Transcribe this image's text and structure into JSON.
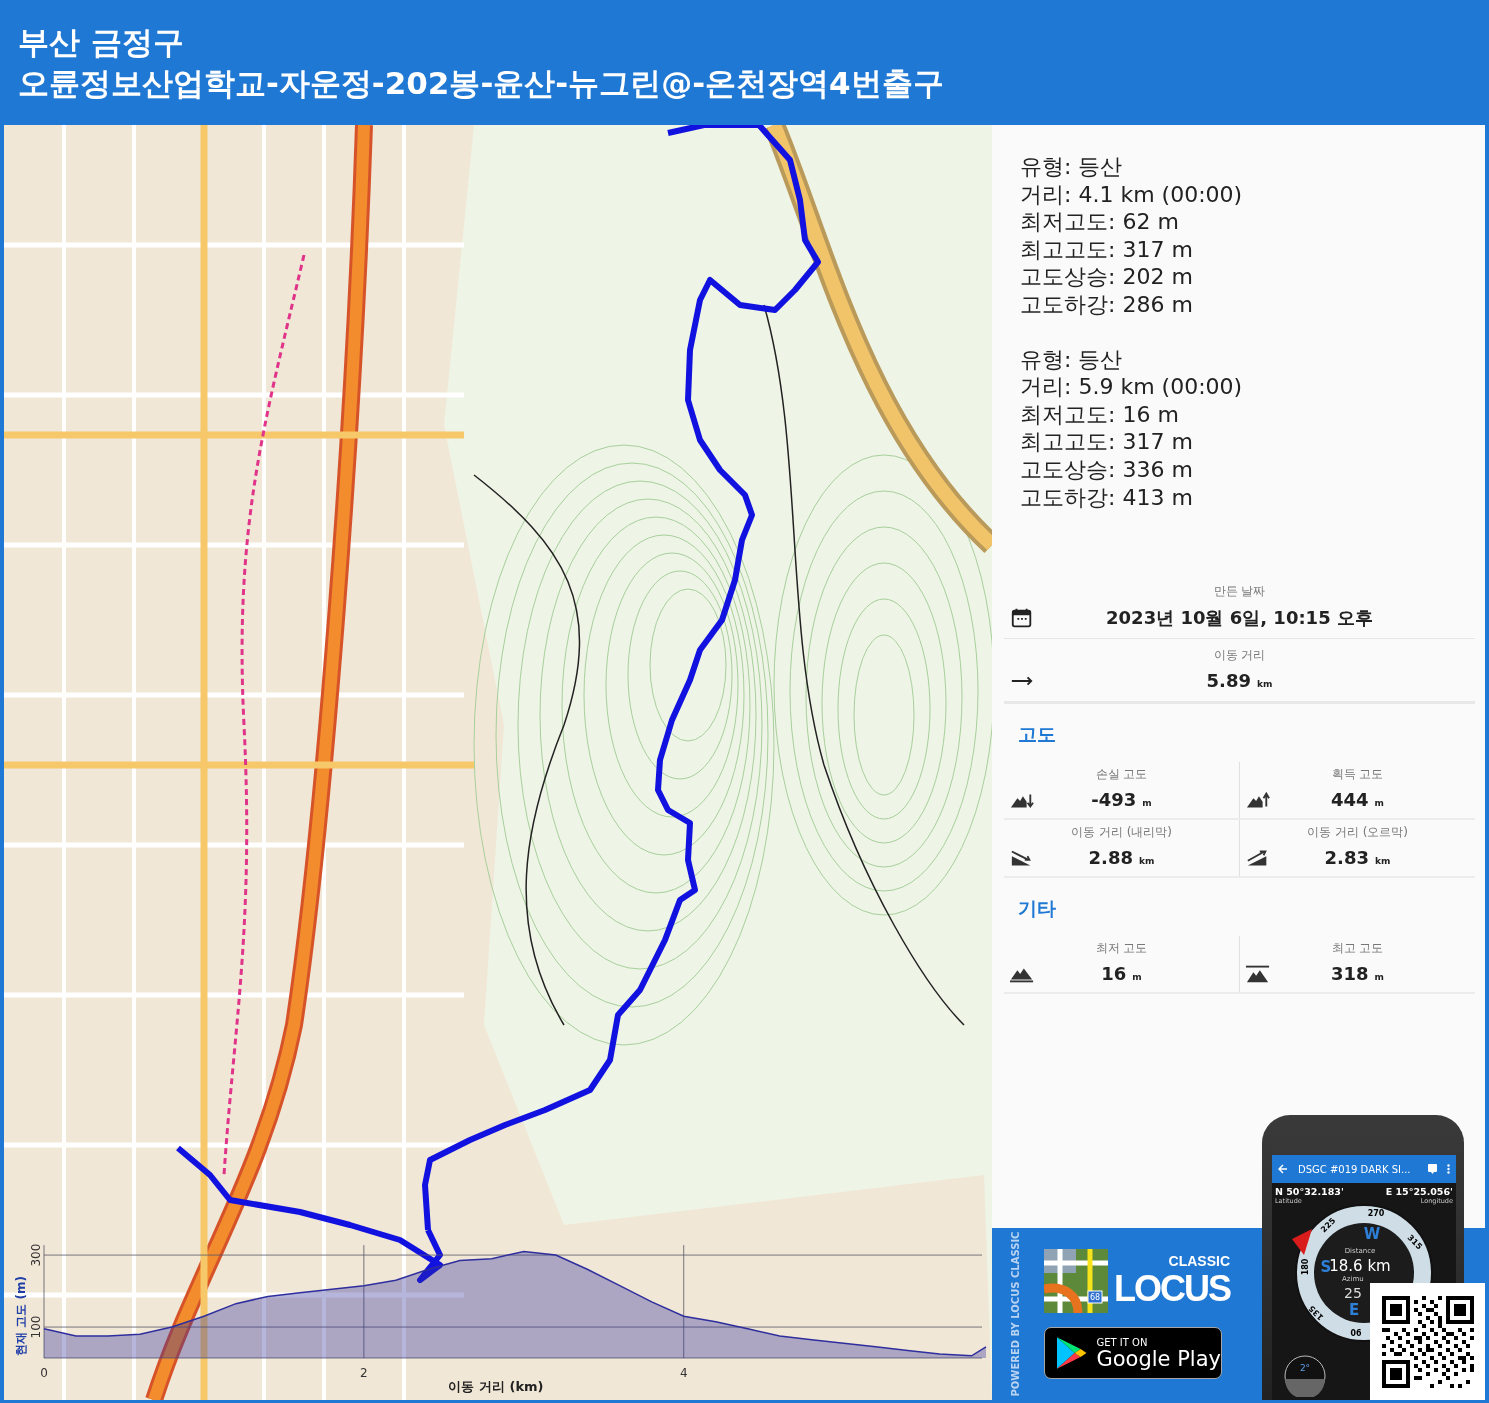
{
  "header": {
    "title_lines": [
      "부산 금정구",
      "오륜정보산업학교-자운정-202봉-윤산-뉴그린@-온천장역4번출구"
    ]
  },
  "map": {
    "elevation_chart": {
      "chart_data": {
        "type": "area",
        "xlabel": "이동 거리 (km)",
        "ylabel": "현재 고도 (m)",
        "x": [
          0,
          0.2,
          0.4,
          0.6,
          0.8,
          1.0,
          1.2,
          1.4,
          1.6,
          1.8,
          2.0,
          2.2,
          2.4,
          2.6,
          2.8,
          3.0,
          3.2,
          3.4,
          3.6,
          3.8,
          4.0,
          4.2,
          4.4,
          4.6,
          4.8,
          5.0,
          5.2,
          5.4,
          5.6,
          5.8,
          5.89
        ],
        "series": [
          {
            "color": "#2e2e9e",
            "values": [
              95,
              75,
              75,
              80,
              100,
              130,
              165,
              185,
              195,
              205,
              215,
              230,
              260,
              285,
              290,
              310,
              300,
              260,
              215,
              170,
              130,
              115,
              95,
              75,
              65,
              55,
              45,
              35,
              25,
              20,
              45
            ]
          }
        ],
        "xlim": [
          0,
          5.89
        ],
        "ylim": [
          14,
          328
        ],
        "xticks": [
          0,
          2,
          4
        ],
        "yticks": [
          100,
          300
        ],
        "grid": true
      }
    }
  },
  "summary": [
    {
      "lines": [
        "유형: 등산",
        "거리: 4.1 km (00:00)",
        "최저고도: 62 m",
        "최고고도: 317 m",
        "고도상승: 202 m",
        "고도하강: 286 m"
      ]
    },
    {
      "lines": [
        "유형: 등산",
        "거리: 5.9 km (00:00)",
        "최저고도: 16 m",
        "최고고도: 317 m",
        "고도상승: 336 m",
        "고도하강: 413 m"
      ]
    }
  ],
  "created": {
    "label": "만든 날짜",
    "value": "2023년 10월 6일, 10:15 오후"
  },
  "distance": {
    "label": "이동 거리",
    "value": "5.89",
    "unit": "km"
  },
  "sections": [
    {
      "title": "고도",
      "rows": [
        [
          {
            "kind": "descent",
            "label": "손실 고도",
            "value": "-493",
            "unit": "m"
          },
          {
            "kind": "ascent",
            "label": "획득 고도",
            "value": "444",
            "unit": "m"
          }
        ],
        [
          {
            "kind": "downhill",
            "label": "이동 거리 (내리막)",
            "value": "2.88",
            "unit": "km"
          },
          {
            "kind": "uphill",
            "label": "이동 거리 (오르막)",
            "value": "2.83",
            "unit": "km"
          }
        ]
      ]
    },
    {
      "title": "기타",
      "rows": [
        [
          {
            "kind": "lowest",
            "label": "최저 고도",
            "value": "16",
            "unit": "m"
          },
          {
            "kind": "highest",
            "label": "최고 고도",
            "value": "318",
            "unit": "m"
          }
        ]
      ]
    }
  ],
  "ad": {
    "powered_by": "POWERED BY LOCUS CLASSIC",
    "logo_small": "CLASSIC",
    "logo_big": "LOCUS",
    "logo_badge": "68",
    "store_small": "GET IT ON",
    "store_big": "Google Play",
    "phone": {
      "title": "DSGC #019 DARK SI...",
      "lat": "N 50°32.183'",
      "lat_label": "Latitude",
      "lon": "E 15°25.056'",
      "lon_label": "Longitude",
      "distance_label": "Distance",
      "distance": "18.6 km",
      "azimuth_label": "Azimu",
      "azimuth": "25",
      "letters": [
        "W",
        "S",
        "E"
      ],
      "degrees": [
        "225",
        "270",
        "315",
        "180",
        "135",
        "90"
      ],
      "tilt": "2°"
    }
  }
}
